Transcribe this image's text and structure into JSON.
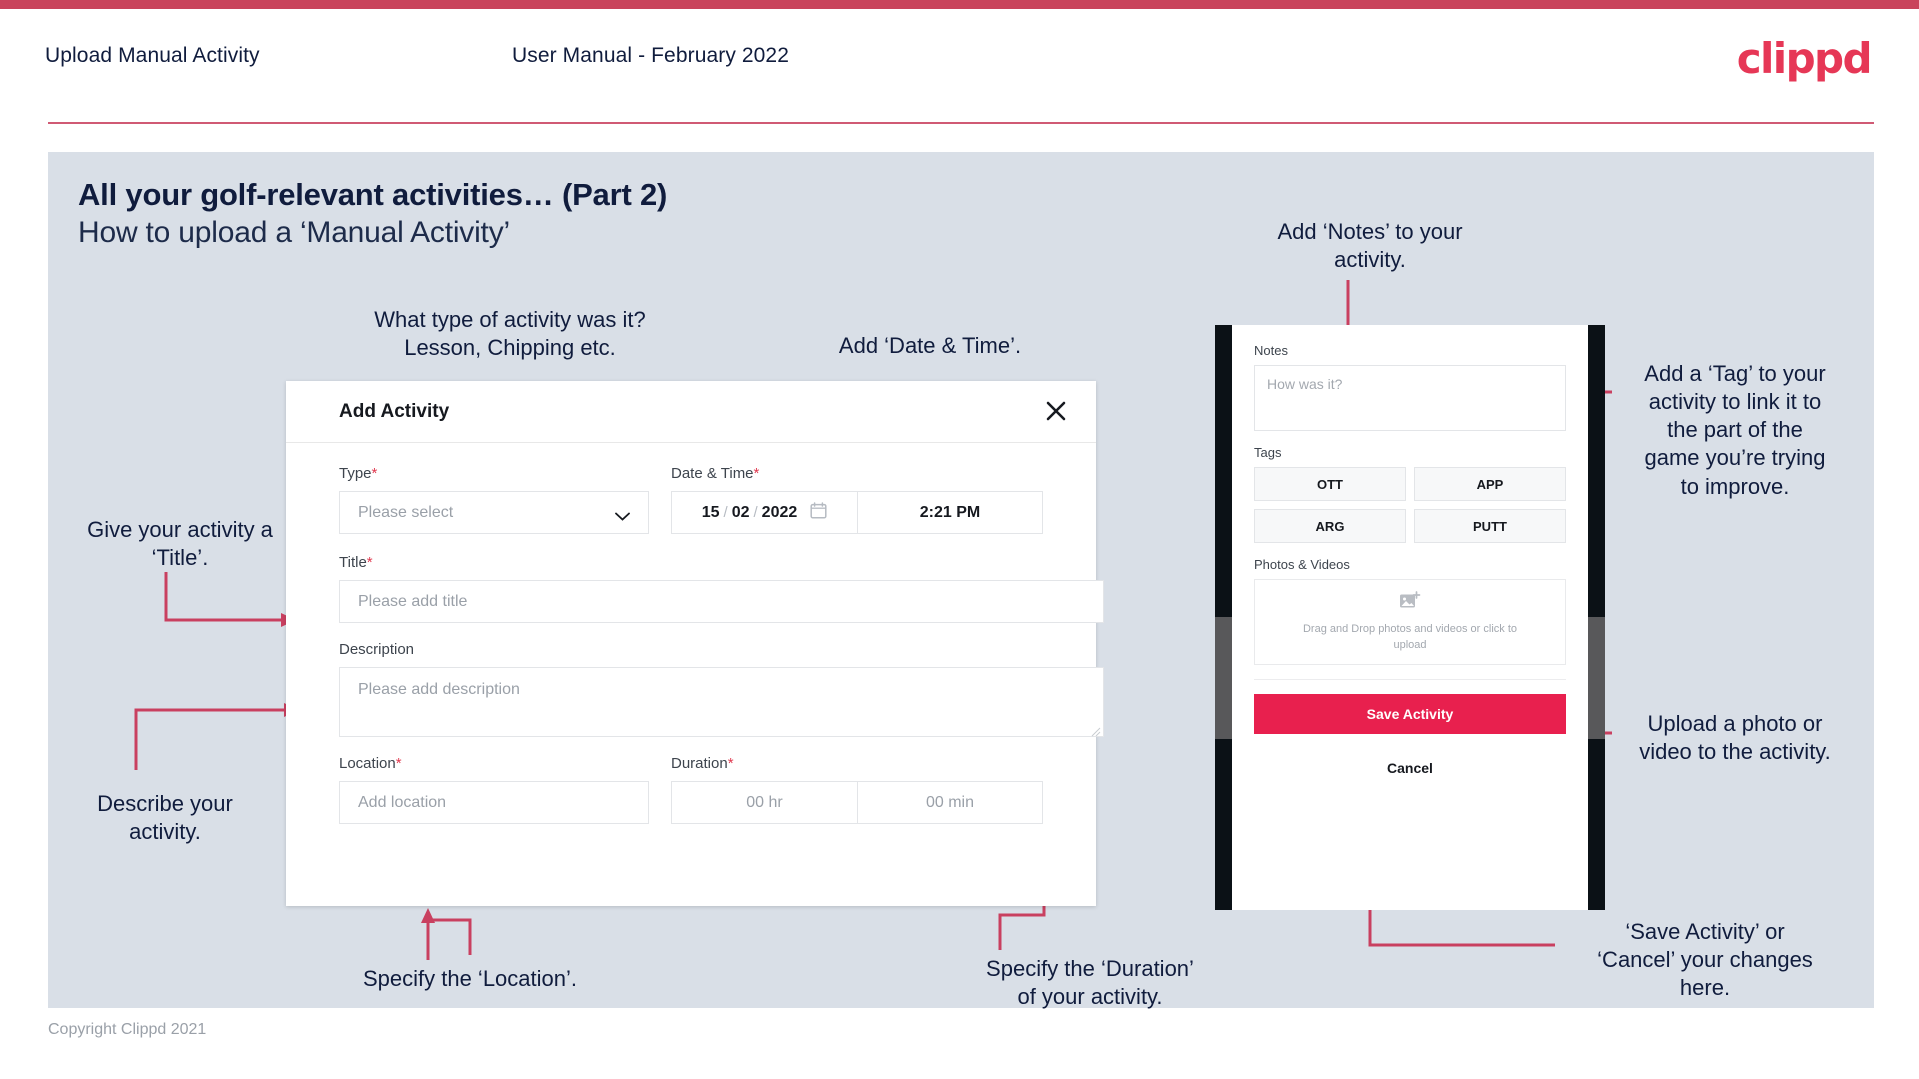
{
  "header": {
    "title": "Upload Manual Activity",
    "subtitle": "User Manual - February 2022",
    "logo": "clippd"
  },
  "slide": {
    "title": "All your golf-relevant activities… (Part 2)",
    "subtitle": "How to upload a ‘Manual Activity’"
  },
  "annotations": {
    "type": "What type of activity was it?\nLesson, Chipping etc.",
    "date_time": "Add ‘Date & Time’.",
    "title": "Give your activity a\n‘Title’.",
    "description": "Describe your\nactivity.",
    "location": "Specify the ‘Location’.",
    "duration": "Specify the ‘Duration’\nof your activity.",
    "notes": "Add ‘Notes’ to your\nactivity.",
    "tags": "Add a ‘Tag’ to your\nactivity to link it to\nthe part of the\ngame you’re trying\nto improve.",
    "photos": "Upload a photo or\nvideo to the activity.",
    "save_cancel": "‘Save Activity’ or\n‘Cancel’ your changes\nhere."
  },
  "dialog": {
    "title": "Add Activity",
    "close_icon": "close-icon",
    "fields": {
      "type": {
        "label": "Type",
        "required": "*",
        "placeholder": "Please select",
        "icon": "chevron-down-icon"
      },
      "datetime": {
        "label": "Date & Time",
        "required": "*",
        "day": "15",
        "sep1": "/",
        "month": "02",
        "sep2": "/",
        "year": "2022",
        "calendar_icon": "calendar-icon",
        "time": "2:21 PM"
      },
      "title": {
        "label": "Title",
        "required": "*",
        "placeholder": "Please add title"
      },
      "description": {
        "label": "Description",
        "placeholder": "Please add description"
      },
      "location": {
        "label": "Location",
        "required": "*",
        "placeholder": "Add location"
      },
      "duration": {
        "label": "Duration",
        "required": "*",
        "hours_placeholder": "00 hr",
        "minutes_placeholder": "00 min"
      }
    }
  },
  "phone": {
    "notes": {
      "label": "Notes",
      "placeholder": "How was it?"
    },
    "tags": {
      "label": "Tags",
      "items": [
        "OTT",
        "APP",
        "ARG",
        "PUTT"
      ]
    },
    "photos": {
      "label": "Photos & Videos",
      "icon": "add-image-icon",
      "dropzone_text": "Drag and Drop photos and videos or click to upload"
    },
    "save_label": "Save Activity",
    "cancel_label": "Cancel"
  },
  "footer": {
    "copyright": "Copyright Clippd 2021"
  },
  "colors": {
    "brand_pink": "#e8204e",
    "accent_crimson": "#c9445c",
    "slide_bg": "#d9dfe7",
    "ink": "#101c3d",
    "connector": "#c94060"
  }
}
